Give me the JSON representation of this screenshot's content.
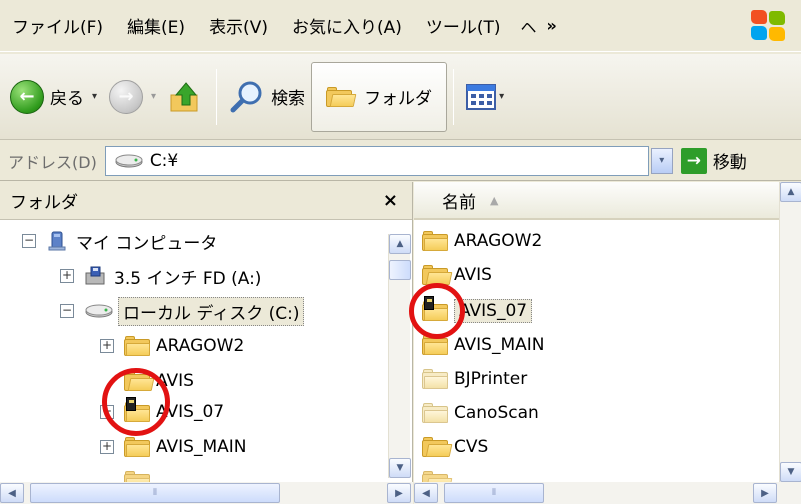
{
  "menu": {
    "items": [
      "ファイル(F)",
      "編集(E)",
      "表示(V)",
      "お気に入り(A)",
      "ツール(T)"
    ],
    "more": "ヘ",
    "chevron": "»"
  },
  "toolbar": {
    "back_label": "戻る",
    "back_arrow": "←",
    "forward_arrow": "→",
    "search_label": "検索",
    "folders_label": "フォルダ",
    "dropdown_caret": "▾"
  },
  "address": {
    "label": "アドレス(D)",
    "value": "C:¥",
    "go_label": "移動",
    "go_arrow": "→"
  },
  "folders_pane": {
    "title": "フォルダ",
    "close": "×",
    "tree": [
      {
        "label": "マイ コンピュータ",
        "expander": "−",
        "icon": "my-computer-icon"
      },
      {
        "label": "3.5 インチ FD (A:)",
        "expander": "+",
        "icon": "floppy-drive-icon"
      },
      {
        "label": "ローカル ディスク (C:)",
        "expander": "−",
        "icon": "hard-drive-icon"
      },
      {
        "label": "ARAGOW2",
        "expander": "+",
        "icon": "folder-icon"
      },
      {
        "label": "AVIS",
        "expander": "",
        "icon": "open-folder-icon"
      },
      {
        "label": "AVIS_07",
        "expander": "+",
        "icon": "program-folder-icon"
      },
      {
        "label": "AVIS_MAIN",
        "expander": "+",
        "icon": "folder-icon"
      }
    ]
  },
  "file_list": {
    "column_name": "名前",
    "sort_indicator": "▲",
    "items": [
      {
        "label": "ARAGOW2",
        "icon": "folder-icon"
      },
      {
        "label": "AVIS",
        "icon": "open-folder-icon"
      },
      {
        "label": "AVIS_07",
        "icon": "program-folder-icon",
        "selected": true
      },
      {
        "label": "AVIS_MAIN",
        "icon": "folder-icon"
      },
      {
        "label": "BJPrinter",
        "icon": "folder-icon"
      },
      {
        "label": "CanoScan",
        "icon": "folder-icon"
      },
      {
        "label": "CVS",
        "icon": "folder-icon"
      }
    ]
  },
  "scroll": {
    "up": "▲",
    "down": "▼",
    "left": "◀",
    "right": "▶",
    "grip": "⦀"
  },
  "colors": {
    "annotation_red": "#e21212",
    "folder_yellow": "#f2c85c",
    "window_bg": "#ece9d8"
  }
}
